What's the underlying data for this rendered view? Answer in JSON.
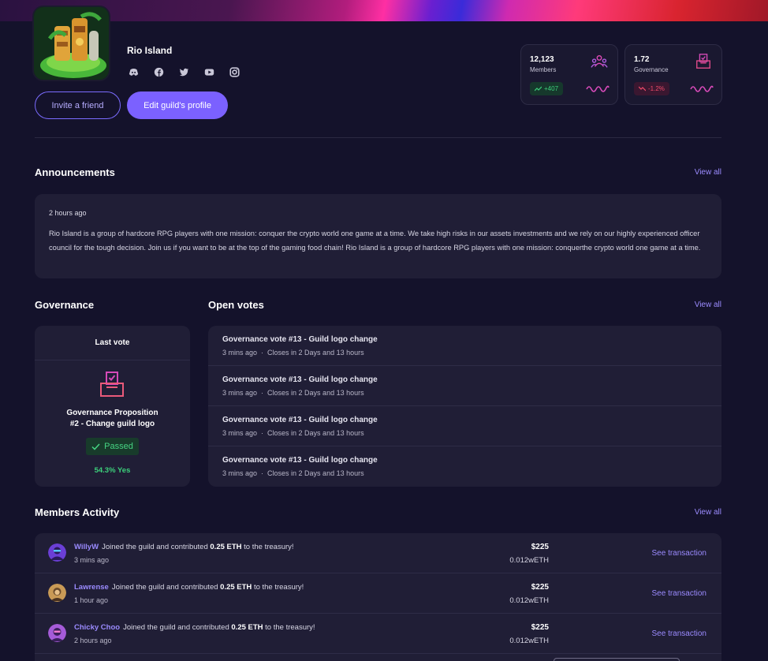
{
  "guild": {
    "name": "Rio Island",
    "invite_label": "Invite a friend",
    "edit_label": "Edit guild's profile",
    "socials": [
      "discord-icon",
      "facebook-icon",
      "twitter-icon",
      "youtube-icon",
      "instagram-icon"
    ]
  },
  "stats": [
    {
      "value": "12,123",
      "label": "Members",
      "change": "+407",
      "trend": "up",
      "icon": "members-icon"
    },
    {
      "value": "1.72",
      "label": "Governance",
      "change": "-1.2%",
      "trend": "down",
      "icon": "ballot-icon"
    }
  ],
  "announcements": {
    "title": "Announcements",
    "view_all": "View all",
    "time": "2 hours ago",
    "text": "Rio Island is a group of hardcore RPG players with one mission: conquer the crypto world one game at a time. We take high risks in our assets investments and we rely on our highly experienced officer council for the tough decision. Join us if you want to be at the top of the gaming food chain! Rio Island is a group of hardcore RPG players with one mission: conquerthe crypto world one game at a time."
  },
  "governance": {
    "title": "Governance",
    "last_vote_label": "Last vote",
    "proposition_line1": "Governance Proposition",
    "proposition_line2": "#2 - Change guild logo",
    "status": "Passed",
    "result": "54.3% Yes"
  },
  "open_votes": {
    "title": "Open votes",
    "view_all": "View all",
    "items": [
      {
        "title": "Governance vote #13 - Guild logo change",
        "age": "3 mins ago",
        "closes": "Closes in 2 Days and 13 hours"
      },
      {
        "title": "Governance vote #13 - Guild logo change",
        "age": "3 mins ago",
        "closes": "Closes in 2 Days and 13 hours"
      },
      {
        "title": "Governance vote #13 - Guild logo change",
        "age": "3 mins ago",
        "closes": "Closes in 2 Days and 13 hours"
      },
      {
        "title": "Governance vote #13 - Guild logo change",
        "age": "3 mins ago",
        "closes": "Closes in 2 Days and 13 hours"
      }
    ]
  },
  "members_activity": {
    "title": "Members Activity",
    "view_all": "View all",
    "items": [
      {
        "name": "WillyW",
        "action_pre": "Joined the guild and contributed",
        "amount": "0.25 ETH",
        "action_post": "to the treasury!",
        "time": "3 mins ago",
        "usd": "$225",
        "eth": "0.012wETH",
        "link": "See transaction",
        "avatar_color": "#6b3fd6"
      },
      {
        "name": "Lawrense",
        "action_pre": "Joined the guild and contributed",
        "amount": "0.25 ETH",
        "action_post": "to the treasury!",
        "time": "1 hour ago",
        "usd": "$225",
        "eth": "0.012wETH",
        "link": "See transaction",
        "avatar_color": "#c99a56"
      },
      {
        "name": "Chicky Choo",
        "action_pre": "Joined the guild and contributed",
        "amount": "0.25 ETH",
        "action_post": "to the treasury!",
        "time": "2 hours ago",
        "usd": "$225",
        "eth": "0.012wETH",
        "link": "See transaction",
        "avatar_color": "#a55bd8"
      }
    ]
  },
  "colors": {
    "background": "#14122b",
    "panel": "#201e36",
    "accent": "#7b61ff",
    "positive": "#3ccf7b",
    "negative": "#f04b6a"
  }
}
